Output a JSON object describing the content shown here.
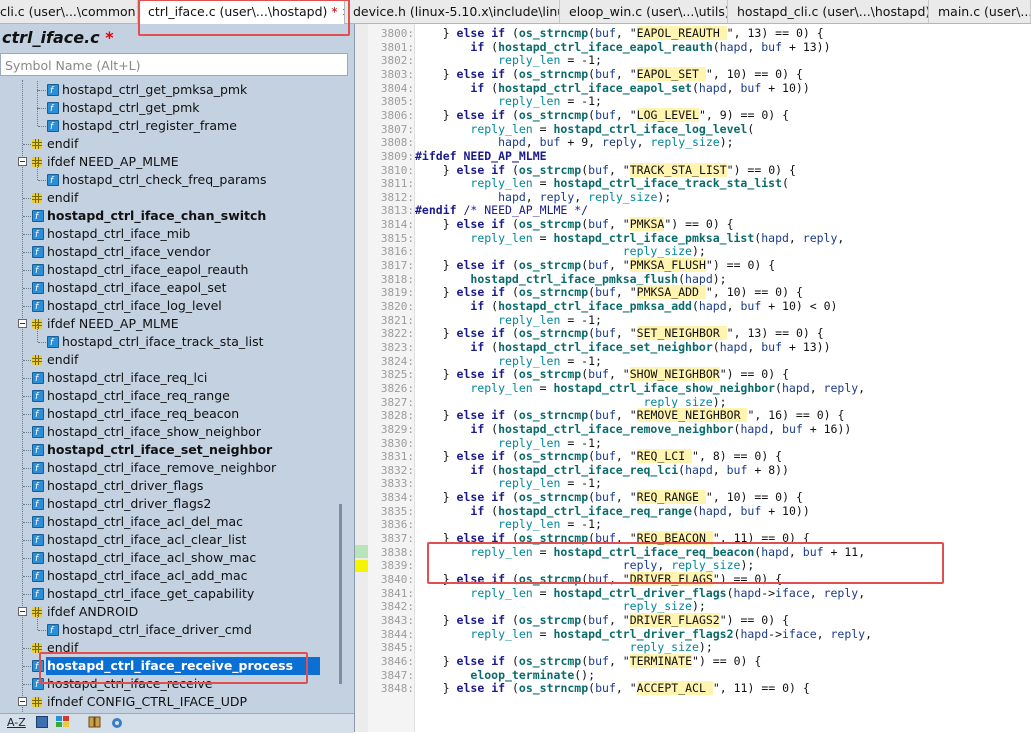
{
  "tabs": [
    {
      "label": "cli.c (user\\...\\common)",
      "active": false
    },
    {
      "label": "ctrl_iface.c (user\\...\\hostapd)",
      "active": true,
      "dirty": "*",
      "close": "✕"
    },
    {
      "label": "device.h (linux-5.10.x\\include\\linux)",
      "active": false
    },
    {
      "label": "eloop_win.c (user\\...\\utils)",
      "active": false
    },
    {
      "label": "hostapd_cli.c (user\\...\\hostapd)",
      "active": false
    },
    {
      "label": "main.c (user\\...\\hostap",
      "active": false
    }
  ],
  "symbol_panel": {
    "file_title": "ctrl_iface.c",
    "file_dirty": "*",
    "search_placeholder": "Symbol Name (Alt+L)",
    "items": [
      {
        "label": "hostapd_ctrl_get_pmksa_pmk",
        "kind": "function",
        "indent": 2,
        "bold": false
      },
      {
        "label": "hostapd_ctrl_get_pmk",
        "kind": "function",
        "indent": 2,
        "bold": false
      },
      {
        "label": "hostapd_ctrl_register_frame",
        "kind": "function",
        "indent": 2,
        "bold": false
      },
      {
        "label": "endif",
        "kind": "preproc",
        "indent": 1,
        "bold": false
      },
      {
        "label": "ifdef NEED_AP_MLME",
        "kind": "preproc-open",
        "indent": 1,
        "bold": false
      },
      {
        "label": "hostapd_ctrl_check_freq_params",
        "kind": "function",
        "indent": 2,
        "bold": false
      },
      {
        "label": "endif",
        "kind": "preproc",
        "indent": 1,
        "bold": false
      },
      {
        "label": "hostapd_ctrl_iface_chan_switch",
        "kind": "function",
        "indent": 1,
        "bold": true
      },
      {
        "label": "hostapd_ctrl_iface_mib",
        "kind": "function",
        "indent": 1,
        "bold": false
      },
      {
        "label": "hostapd_ctrl_iface_vendor",
        "kind": "function",
        "indent": 1,
        "bold": false
      },
      {
        "label": "hostapd_ctrl_iface_eapol_reauth",
        "kind": "function",
        "indent": 1,
        "bold": false
      },
      {
        "label": "hostapd_ctrl_iface_eapol_set",
        "kind": "function",
        "indent": 1,
        "bold": false
      },
      {
        "label": "hostapd_ctrl_iface_log_level",
        "kind": "function",
        "indent": 1,
        "bold": false
      },
      {
        "label": "ifdef NEED_AP_MLME",
        "kind": "preproc-open",
        "indent": 1,
        "bold": false
      },
      {
        "label": "hostapd_ctrl_iface_track_sta_list",
        "kind": "function",
        "indent": 2,
        "bold": false
      },
      {
        "label": "endif",
        "kind": "preproc",
        "indent": 1,
        "bold": false
      },
      {
        "label": "hostapd_ctrl_iface_req_lci",
        "kind": "function",
        "indent": 1,
        "bold": false
      },
      {
        "label": "hostapd_ctrl_iface_req_range",
        "kind": "function",
        "indent": 1,
        "bold": false
      },
      {
        "label": "hostapd_ctrl_iface_req_beacon",
        "kind": "function",
        "indent": 1,
        "bold": false
      },
      {
        "label": "hostapd_ctrl_iface_show_neighbor",
        "kind": "function",
        "indent": 1,
        "bold": false
      },
      {
        "label": "hostapd_ctrl_iface_set_neighbor",
        "kind": "function",
        "indent": 1,
        "bold": true
      },
      {
        "label": "hostapd_ctrl_iface_remove_neighbor",
        "kind": "function",
        "indent": 1,
        "bold": false
      },
      {
        "label": "hostapd_ctrl_driver_flags",
        "kind": "function",
        "indent": 1,
        "bold": false
      },
      {
        "label": "hostapd_ctrl_driver_flags2",
        "kind": "function",
        "indent": 1,
        "bold": false
      },
      {
        "label": "hostapd_ctrl_iface_acl_del_mac",
        "kind": "function",
        "indent": 1,
        "bold": false
      },
      {
        "label": "hostapd_ctrl_iface_acl_clear_list",
        "kind": "function",
        "indent": 1,
        "bold": false
      },
      {
        "label": "hostapd_ctrl_iface_acl_show_mac",
        "kind": "function",
        "indent": 1,
        "bold": false
      },
      {
        "label": "hostapd_ctrl_iface_acl_add_mac",
        "kind": "function",
        "indent": 1,
        "bold": false
      },
      {
        "label": "hostapd_ctrl_iface_get_capability",
        "kind": "function",
        "indent": 1,
        "bold": false
      },
      {
        "label": "ifdef ANDROID",
        "kind": "preproc-open",
        "indent": 1,
        "bold": false
      },
      {
        "label": "hostapd_ctrl_iface_driver_cmd",
        "kind": "function",
        "indent": 2,
        "bold": false
      },
      {
        "label": "endif",
        "kind": "preproc",
        "indent": 1,
        "bold": false
      },
      {
        "label": "hostapd_ctrl_iface_receive_process",
        "kind": "function",
        "indent": 1,
        "bold": true,
        "selected": true
      },
      {
        "label": "hostapd_ctrl_iface_receive",
        "kind": "function",
        "indent": 1,
        "bold": false
      },
      {
        "label": "ifndef CONFIG_CTRL_IFACE_UDP",
        "kind": "preproc-open",
        "indent": 1,
        "bold": false
      }
    ],
    "toolbar": {
      "sort_label": "A-Z"
    }
  },
  "editor": {
    "lines": [
      {
        "n": "3800:",
        "t": "    } else if (os_strncmp(buf, \"EAPOL_REAUTH \", 13) == 0) {"
      },
      {
        "n": "3801:",
        "t": "        if (hostapd_ctrl_iface_eapol_reauth(hapd, buf + 13))"
      },
      {
        "n": "3802:",
        "t": "            reply_len = -1;"
      },
      {
        "n": "3803:",
        "t": "    } else if (os_strncmp(buf, \"EAPOL_SET \", 10) == 0) {"
      },
      {
        "n": "3804:",
        "t": "        if (hostapd_ctrl_iface_eapol_set(hapd, buf + 10))"
      },
      {
        "n": "3805:",
        "t": "            reply_len = -1;"
      },
      {
        "n": "3806:",
        "t": "    } else if (os_strncmp(buf, \"LOG_LEVEL\", 9) == 0) {"
      },
      {
        "n": "3807:",
        "t": "        reply_len = hostapd_ctrl_iface_log_level("
      },
      {
        "n": "3808:",
        "t": "            hapd, buf + 9, reply, reply_size);"
      },
      {
        "n": "3809:",
        "t": "#ifdef NEED_AP_MLME"
      },
      {
        "n": "3810:",
        "t": "    } else if (os_strcmp(buf, \"TRACK_STA_LIST\") == 0) {"
      },
      {
        "n": "3811:",
        "t": "        reply_len = hostapd_ctrl_iface_track_sta_list("
      },
      {
        "n": "3812:",
        "t": "            hapd, reply, reply_size);"
      },
      {
        "n": "3813:",
        "t": "#endif /* NEED_AP_MLME */"
      },
      {
        "n": "3814:",
        "t": "    } else if (os_strcmp(buf, \"PMKSA\") == 0) {"
      },
      {
        "n": "3815:",
        "t": "        reply_len = hostapd_ctrl_iface_pmksa_list(hapd, reply,"
      },
      {
        "n": "3816:",
        "t": "                              reply_size);"
      },
      {
        "n": "3817:",
        "t": "    } else if (os_strcmp(buf, \"PMKSA_FLUSH\") == 0) {"
      },
      {
        "n": "3818:",
        "t": "        hostapd_ctrl_iface_pmksa_flush(hapd);"
      },
      {
        "n": "3819:",
        "t": "    } else if (os_strncmp(buf, \"PMKSA_ADD \", 10) == 0) {"
      },
      {
        "n": "3820:",
        "t": "        if (hostapd_ctrl_iface_pmksa_add(hapd, buf + 10) < 0)"
      },
      {
        "n": "3821:",
        "t": "            reply_len = -1;"
      },
      {
        "n": "3822:",
        "t": "    } else if (os_strncmp(buf, \"SET_NEIGHBOR \", 13) == 0) {"
      },
      {
        "n": "3823:",
        "t": "        if (hostapd_ctrl_iface_set_neighbor(hapd, buf + 13))"
      },
      {
        "n": "3824:",
        "t": "            reply_len = -1;"
      },
      {
        "n": "3825:",
        "t": "    } else if (os_strcmp(buf, \"SHOW_NEIGHBOR\") == 0) {"
      },
      {
        "n": "3826:",
        "t": "        reply_len = hostapd_ctrl_iface_show_neighbor(hapd, reply,"
      },
      {
        "n": "3827:",
        "t": "                                 reply_size);"
      },
      {
        "n": "3828:",
        "t": "    } else if (os_strncmp(buf, \"REMOVE_NEIGHBOR \", 16) == 0) {"
      },
      {
        "n": "3829:",
        "t": "        if (hostapd_ctrl_iface_remove_neighbor(hapd, buf + 16))"
      },
      {
        "n": "3830:",
        "t": "            reply_len = -1;"
      },
      {
        "n": "3831:",
        "t": "    } else if (os_strncmp(buf, \"REQ_LCI \", 8) == 0) {"
      },
      {
        "n": "3832:",
        "t": "        if (hostapd_ctrl_iface_req_lci(hapd, buf + 8))"
      },
      {
        "n": "3833:",
        "t": "            reply_len = -1;"
      },
      {
        "n": "3834:",
        "t": "    } else if (os_strncmp(buf, \"REQ_RANGE \", 10) == 0) {"
      },
      {
        "n": "3835:",
        "t": "        if (hostapd_ctrl_iface_req_range(hapd, buf + 10))"
      },
      {
        "n": "3836:",
        "t": "            reply_len = -1;"
      },
      {
        "n": "3837:",
        "t": "    } else if (os_strncmp(buf, \"REQ_BEACON \", 11) == 0) {"
      },
      {
        "n": "3838:",
        "t": "        reply_len = hostapd_ctrl_iface_req_beacon(hapd, buf + 11,"
      },
      {
        "n": "3839:",
        "t": "                              reply, reply_size);"
      },
      {
        "n": "3840:",
        "t": "    } else if (os_strcmp(buf, \"DRIVER_FLAGS\") == 0) {"
      },
      {
        "n": "3841:",
        "t": "        reply_len = hostapd_ctrl_driver_flags(hapd->iface, reply,"
      },
      {
        "n": "3842:",
        "t": "                              reply_size);"
      },
      {
        "n": "3843:",
        "t": "    } else if (os_strcmp(buf, \"DRIVER_FLAGS2\") == 0) {"
      },
      {
        "n": "3844:",
        "t": "        reply_len = hostapd_ctrl_driver_flags2(hapd->iface, reply,"
      },
      {
        "n": "3845:",
        "t": "                               reply_size);"
      },
      {
        "n": "3846:",
        "t": "    } else if (os_strcmp(buf, \"TERMINATE\") == 0) {"
      },
      {
        "n": "3847:",
        "t": "        eloop_terminate();"
      },
      {
        "n": "3848:",
        "t": "    } else if (os_strncmp(buf, \"ACCEPT_ACL \", 11) == 0) {"
      }
    ]
  },
  "colors": {
    "highlight_box": "#e05050",
    "selection": "#0c6fd3",
    "panel_bg": "#c3d1e1",
    "string_bg": "#fff4b0"
  }
}
